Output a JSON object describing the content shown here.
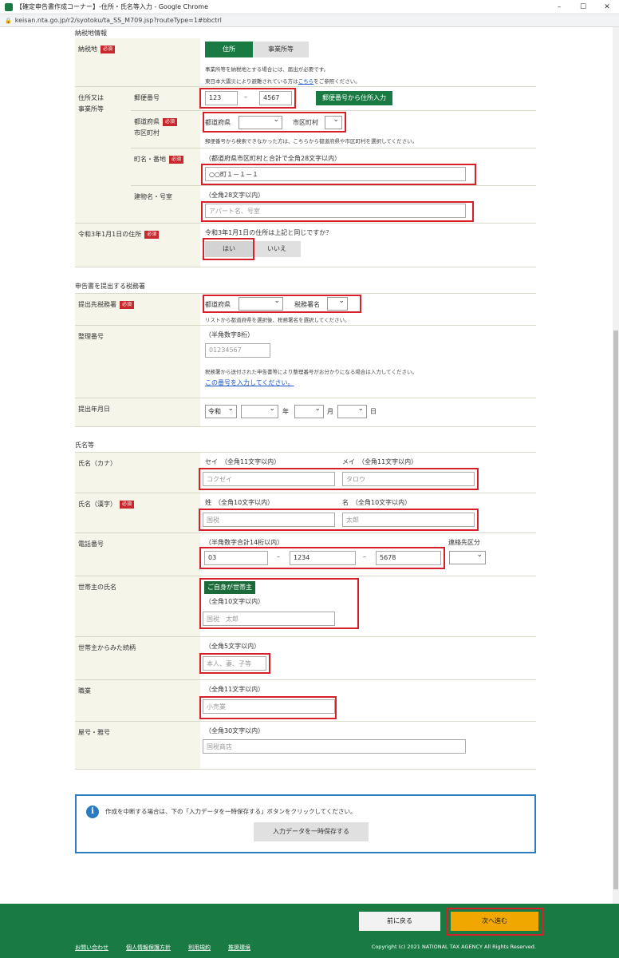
{
  "window": {
    "title": "【確定申告書作成コーナー】-住所・氏名等入力 - Google Chrome",
    "url": "keisan.nta.go.jp/r2/syotoku/ta_SS_M709.jsp?routeType=1#bbctrl",
    "controls": [
      "–",
      "☐",
      "✕"
    ]
  },
  "required_badge": "必須",
  "tax_place": {
    "section_title": "納税地情報",
    "label": "納税地",
    "tabs": [
      "住所",
      "事業所等"
    ],
    "note1": "事業所等を納税地とする場合には、届出が必要です。",
    "note2_prefix": "東日本大震災により避難されている方は",
    "note2_link": "こちら",
    "note2_suffix": "をご参照ください。"
  },
  "address": {
    "label_line1": "住所又は",
    "label_line2": "事業所等",
    "postal_label": "郵便番号",
    "postal1": "123",
    "postal2": "4567",
    "postal_dash": "–",
    "postal_button": "郵便番号から住所入力",
    "pref_label_line1": "都道府県",
    "pref_label_line2": "市区町村",
    "pref_field_label": "都道府県",
    "city_field_label": "市区町村",
    "pref_note": "郵便番号から検索できなかった方は、こちらから都道府県や市区町村を選択してください。",
    "street_label": "町名・番地",
    "street_hint": "（都道府県市区町村と合計で全角28文字以内）",
    "street_value": "○○町１－１－１",
    "building_label": "建物名・号室",
    "building_hint": "（全角28文字以内）",
    "building_placeholder": "アパート名、号室"
  },
  "prev_address": {
    "label": "令和3年1月1日の住所",
    "question": "令和3年1月1日の住所は上記と同じですか？",
    "yes": "はい",
    "no": "いいえ"
  },
  "tax_office": {
    "section_title": "申告書を提出する税務署",
    "label": "提出先税務署",
    "pref_field_label": "都道府県",
    "office_field_label": "税務署名",
    "note": "リストから都道府県を選択後、税務署名を選択してください。",
    "ref_label": "整理番号",
    "ref_hint": "（半角数字8桁）",
    "ref_placeholder": "01234567",
    "ref_note": "税務署から送付された申告書等により整理番号がお分かりになる場合は入力してください。",
    "ref_link": "この番号を入力してください。",
    "date_label": "提出年月日",
    "era": "令和",
    "year_suffix": "年",
    "month_suffix": "月",
    "day_suffix": "日"
  },
  "name": {
    "section_title": "氏名等",
    "kana_label": "氏名（カナ）",
    "kana_sei_hint": "セイ　（全角11文字以内）",
    "kana_mei_hint": "メイ　（全角11文字以内）",
    "kana_sei_placeholder": "コクゼイ",
    "kana_mei_placeholder": "タロウ",
    "kanji_label": "氏名（漢字）",
    "kanji_sei_hint": "姓　（全角10文字以内）",
    "kanji_mei_hint": "名　（全角10文字以内）",
    "kanji_sei_placeholder": "国税",
    "kanji_mei_placeholder": "太郎",
    "phone_label": "電話番号",
    "phone_hint": "（半角数字合計14桁以内）",
    "phone1": "03",
    "phone2": "1234",
    "phone3": "5678",
    "phone_dash": "–",
    "phone_type_label": "連絡先区分",
    "householder_label": "世帯主の氏名",
    "householder_button": "ご自身が世帯主",
    "householder_hint": "（全角10文字以内）",
    "householder_placeholder": "国税　太郎",
    "relation_label": "世帯主からみた続柄",
    "relation_hint": "（全角5文字以内）",
    "relation_placeholder": "本人、妻、子等",
    "job_label": "職業",
    "job_hint": "（全角11文字以内）",
    "job_placeholder": "小売業",
    "trade_label": "屋号・雅号",
    "trade_hint": "（全角30文字以内）",
    "trade_placeholder": "国税商店"
  },
  "info": {
    "icon": "i",
    "message": "作成を中断する場合は、下の「入力データを一時保存する」ボタンをクリックしてください。",
    "save_button": "入力データを一時保存する"
  },
  "footer": {
    "back": "前に戻る",
    "next": "次へ進む",
    "links": [
      "お問い合わせ",
      "個人情報保護方針",
      "利用規約",
      "推奨環境"
    ],
    "copyright": "Copyright (c) 2021 NATIONAL TAX AGENCY All Rights Reserved."
  },
  "colors": {
    "green": "#1a7a44",
    "red": "#d6212b",
    "blue": "#2a7bbf",
    "orange": "#f0a800"
  }
}
